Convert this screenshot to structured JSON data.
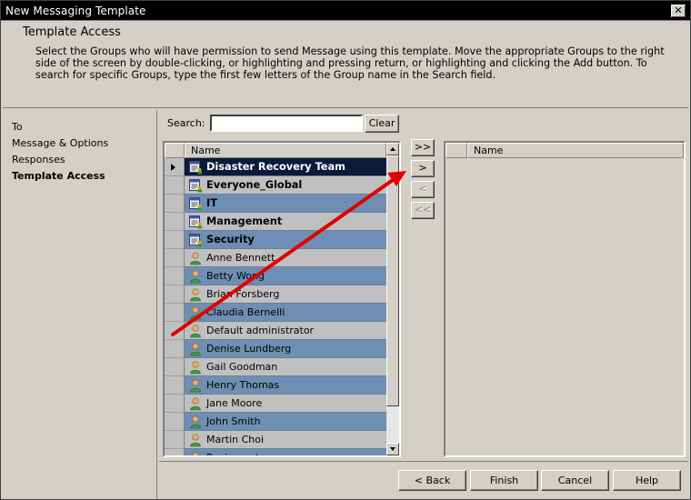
{
  "window": {
    "title": "New Messaging Template",
    "close_glyph": "✕"
  },
  "header": {
    "title": "Template Access",
    "description": "Select the Groups who will have permission to send Message using this template. Move the appropriate Groups to the right side of the screen by double-clicking, or highlighting and pressing return, or highlighting and clicking the Add button. To search for specific Groups, type the first few letters of the Group name in the Search field."
  },
  "nav": {
    "items": [
      {
        "label": "To",
        "active": false
      },
      {
        "label": "Message & Options",
        "active": false
      },
      {
        "label": "Responses",
        "active": false
      },
      {
        "label": "Template Access",
        "active": true
      }
    ]
  },
  "search": {
    "label": "Search:",
    "value": "",
    "clear_label": "Clear"
  },
  "left_list": {
    "header": "Name",
    "rows": [
      {
        "name": "Disaster Recovery Team",
        "type": "group",
        "current": true
      },
      {
        "name": "Everyone_Global",
        "type": "group"
      },
      {
        "name": "IT",
        "type": "group"
      },
      {
        "name": "Management",
        "type": "group"
      },
      {
        "name": "Security",
        "type": "group"
      },
      {
        "name": "Anne Bennett",
        "type": "user"
      },
      {
        "name": "Betty Wong",
        "type": "user"
      },
      {
        "name": "Brian Forsberg",
        "type": "user"
      },
      {
        "name": "Claudia Bernelli",
        "type": "user"
      },
      {
        "name": "Default administrator",
        "type": "user"
      },
      {
        "name": "Denise Lundberg",
        "type": "user"
      },
      {
        "name": "Gail Goodman",
        "type": "user"
      },
      {
        "name": "Henry Thomas",
        "type": "user"
      },
      {
        "name": "Jane Moore",
        "type": "user"
      },
      {
        "name": "John Smith",
        "type": "user"
      },
      {
        "name": "Martin Choi",
        "type": "user"
      },
      {
        "name": "Paging gateway user",
        "type": "user"
      }
    ]
  },
  "move_buttons": {
    "add_all": ">>",
    "add": ">",
    "remove": "<",
    "remove_all": "<<"
  },
  "right_list": {
    "header": "Name"
  },
  "footer": {
    "back": "< Back",
    "finish": "Finish",
    "cancel": "Cancel",
    "help": "Help"
  },
  "icons": {
    "group": "group-list-icon",
    "user": "user-icon",
    "pointer": "row-pointer-icon"
  },
  "colors": {
    "row_alt": "#6e8fb3",
    "row_plain": "#c0c0c0",
    "row_current": "#0a1a3a",
    "annotation_arrow": "#e00000"
  }
}
